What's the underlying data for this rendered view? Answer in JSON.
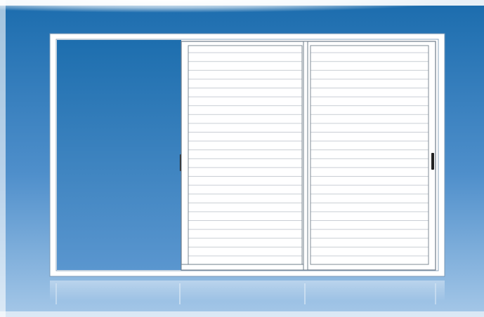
{
  "scene": {
    "subject": "sliding-window",
    "panes": [
      {
        "role": "open-glass",
        "shutter": false,
        "handle": true
      },
      {
        "role": "sliding-shutter",
        "shutter": true,
        "handle": false
      },
      {
        "role": "fixed-shutter",
        "shutter": true,
        "handle": true
      }
    ]
  },
  "colors": {
    "background_top": "#1b6cad",
    "background_bottom": "#9cc3e6",
    "frame": "#ffffff",
    "frame_outline": "#6e8fae",
    "slat_line": "#c9ced4",
    "handle": "#222222",
    "corner_glow": "#f3f4f6"
  },
  "icons": {
    "handle": "window-handle-icon"
  }
}
